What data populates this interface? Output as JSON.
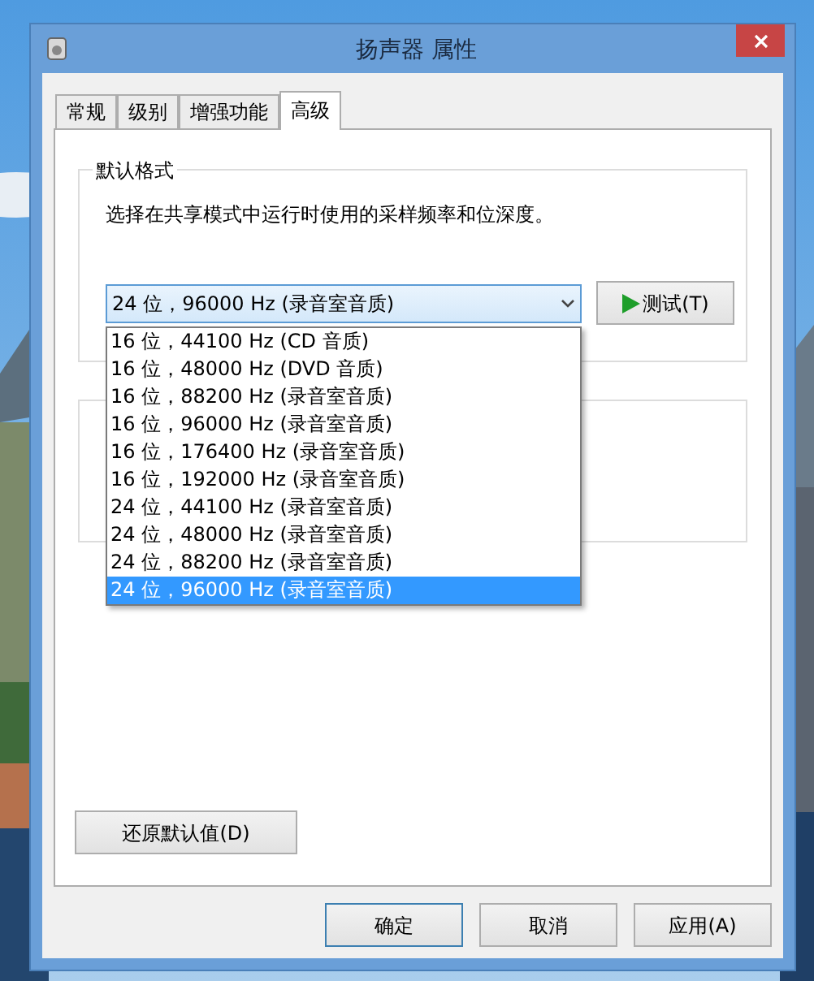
{
  "window": {
    "title": "扬声器 属性"
  },
  "tabs": [
    {
      "label": "常规",
      "selected": false
    },
    {
      "label": "级别",
      "selected": false
    },
    {
      "label": "增强功能",
      "selected": false
    },
    {
      "label": "高级",
      "selected": true
    }
  ],
  "default_format": {
    "legend": "默认格式",
    "description": "选择在共享模式中运行时使用的采样频率和位深度。",
    "value": "24 位，96000 Hz (录音室音质)",
    "expanded": true,
    "test_button": "测试(T)",
    "options": [
      {
        "label": "16 位，44100 Hz (CD 音质)",
        "selected": false
      },
      {
        "label": "16 位，48000 Hz (DVD 音质)",
        "selected": false
      },
      {
        "label": "16 位，88200 Hz (录音室音质)",
        "selected": false
      },
      {
        "label": "16 位，96000 Hz (录音室音质)",
        "selected": false
      },
      {
        "label": "16 位，176400 Hz (录音室音质)",
        "selected": false
      },
      {
        "label": "16 位，192000 Hz (录音室音质)",
        "selected": false
      },
      {
        "label": "24 位，44100 Hz (录音室音质)",
        "selected": false
      },
      {
        "label": "24 位，48000 Hz (录音室音质)",
        "selected": false
      },
      {
        "label": "24 位，88200 Hz (录音室音质)",
        "selected": false
      },
      {
        "label": "24 位，96000 Hz (录音室音质)",
        "selected": true
      }
    ]
  },
  "restore_button": "还原默认值(D)",
  "buttons": [
    {
      "label": "确定",
      "default": true
    },
    {
      "label": "取消",
      "default": false
    },
    {
      "label": "应用(A)",
      "default": false
    }
  ]
}
